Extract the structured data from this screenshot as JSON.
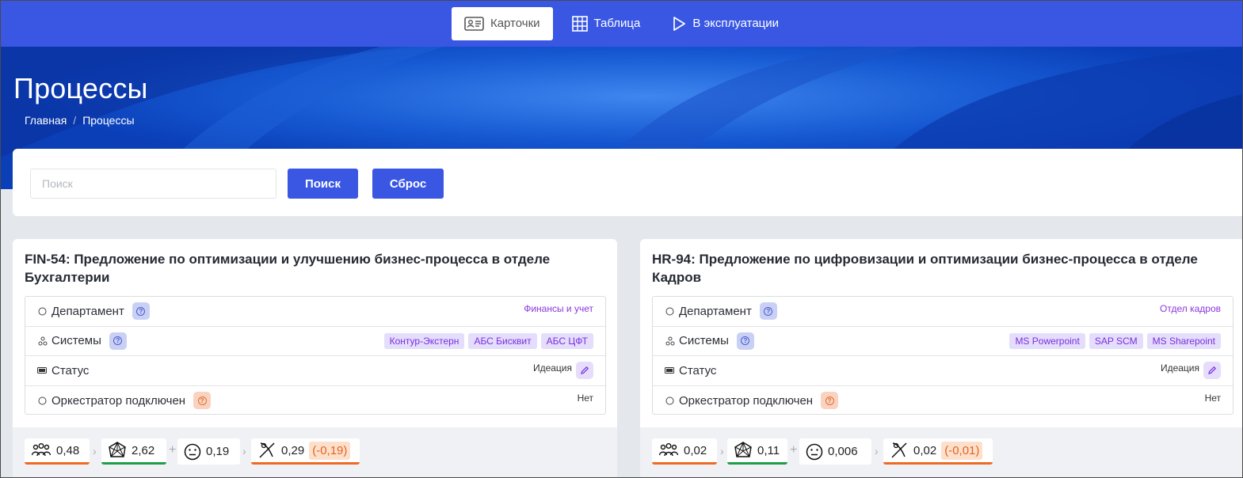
{
  "nav": {
    "tabs": [
      {
        "label": "Карточки",
        "icon": "id-card-icon",
        "active": true
      },
      {
        "label": "Таблица",
        "icon": "grid-table-icon",
        "active": false
      },
      {
        "label": "В эксплуатации",
        "icon": "play-icon",
        "active": false
      }
    ]
  },
  "header": {
    "title": "Процессы",
    "breadcrumb": [
      "Главная",
      "Процессы"
    ],
    "breadcrumb_separator": "/"
  },
  "search": {
    "placeholder": "Поиск",
    "value": "",
    "search_label": "Поиск",
    "reset_label": "Сброс"
  },
  "cards": [
    {
      "title": "FIN-54: Предложение по оптимизации и улучшению бизнес-процесса в отделе Бухгалтерии",
      "props": {
        "department_label": "Департамент",
        "department_value": "Финансы и учет",
        "systems_label": "Системы",
        "systems": [
          "Контур-Экстерн",
          "АБС Бисквит",
          "АБС ЦФТ"
        ],
        "status_label": "Статус",
        "status_value": "Идеация",
        "orchestrator_label": "Оркестратор подключен",
        "orchestrator_value": "Нет"
      },
      "metrics": {
        "people": "0,48",
        "complexity": "2,62",
        "satisfaction": "0,19",
        "effect": "0,29",
        "effect_delta": "(-0,19)"
      }
    },
    {
      "title": "HR-94: Предложение по цифровизации и оптимизации бизнес-процесса в отделе Кадров",
      "props": {
        "department_label": "Департамент",
        "department_value": "Отдел кадров",
        "systems_label": "Системы",
        "systems": [
          "MS Powerpoint",
          "SAP SCM",
          "MS Sharepoint"
        ],
        "status_label": "Статус",
        "status_value": "Идеация",
        "orchestrator_label": "Оркестратор подключен",
        "orchestrator_value": "Нет"
      },
      "metrics": {
        "people": "0,02",
        "complexity": "0,11",
        "satisfaction": "0,006",
        "effect": "0,02",
        "effect_delta": "(-0,01)"
      }
    }
  ],
  "colors": {
    "primary": "#3a57e4",
    "hero": "#0a3fb8",
    "tag_bg": "#e4ddfb",
    "tag_text": "#7a2fe0",
    "underline_orange": "#ee6a22",
    "underline_green": "#1c9e47"
  }
}
